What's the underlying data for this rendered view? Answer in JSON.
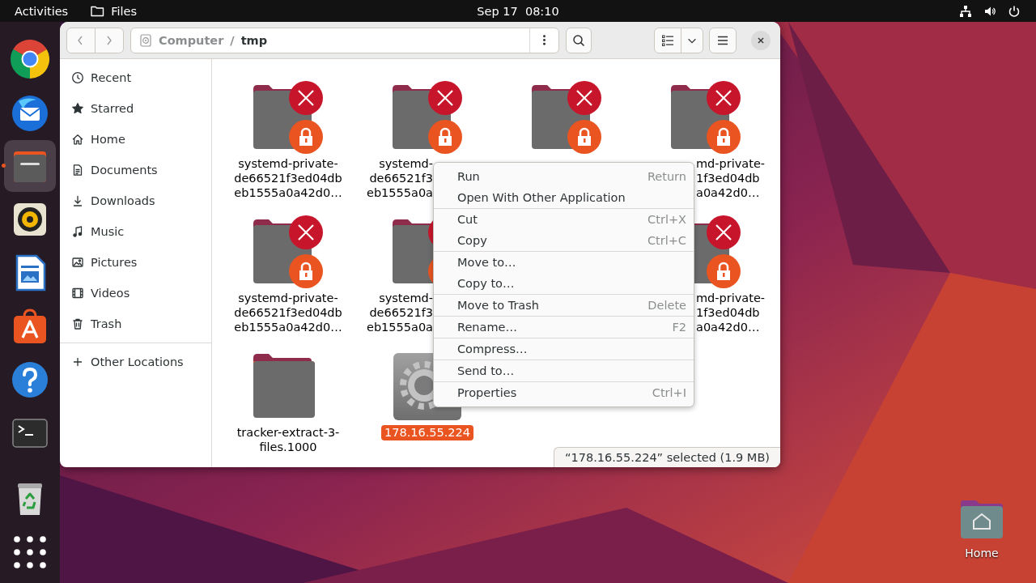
{
  "top_bar": {
    "activities": "Activities",
    "app_name": "Files",
    "clock": "Sep 17  08:10"
  },
  "dock": [
    {
      "kind": "browser",
      "running": false
    },
    {
      "kind": "mail",
      "running": false
    },
    {
      "kind": "files",
      "running": true
    },
    {
      "kind": "music",
      "running": false
    },
    {
      "kind": "writer",
      "running": false
    },
    {
      "kind": "store",
      "running": false
    },
    {
      "kind": "help",
      "running": false
    },
    {
      "kind": "terminal",
      "running": false
    },
    {
      "kind": "trash",
      "running": false
    },
    {
      "kind": "app-grid",
      "running": false
    }
  ],
  "window": {
    "path": [
      {
        "kind": "segment",
        "label": "Computer"
      },
      {
        "kind": "separator",
        "label": "/"
      },
      {
        "kind": "segment",
        "label": "tmp"
      }
    ],
    "sidebar": [
      {
        "kind": "recent",
        "label": "Recent",
        "selected": false
      },
      {
        "kind": "starred",
        "label": "Starred",
        "selected": false
      },
      {
        "kind": "home",
        "label": "Home",
        "selected": false
      },
      {
        "kind": "documents",
        "label": "Documents",
        "selected": false
      },
      {
        "kind": "downloads",
        "label": "Downloads",
        "selected": false
      },
      {
        "kind": "music",
        "label": "Music",
        "selected": false
      },
      {
        "kind": "pictures",
        "label": "Pictures",
        "selected": false
      },
      {
        "kind": "videos",
        "label": "Videos",
        "selected": false
      },
      {
        "kind": "trash",
        "label": "Trash",
        "selected": false
      },
      {
        "kind": "other",
        "label": "Other Locations",
        "selected": false
      }
    ],
    "items": [
      {
        "kind": "locked-folder",
        "label_lines": [
          "systemd-private-",
          "de66521f3ed04db",
          "eb1555a0a42d0…"
        ],
        "selected": false
      },
      {
        "kind": "locked-folder",
        "label_lines": [
          "systemd-",
          "de66521f3",
          "eb1555a0a"
        ],
        "selected": false
      },
      {
        "kind": "locked-folder",
        "selected": false
      },
      {
        "kind": "locked-folder",
        "label_lines": [
          "md-private-",
          "1f3ed04db",
          "a0a42d0…"
        ],
        "selected": false
      },
      {
        "kind": "locked-folder",
        "label_lines": [
          "systemd-private-",
          "de66521f3ed04db",
          "eb1555a0a42d0…"
        ],
        "selected": false
      },
      {
        "kind": "locked-folder",
        "label_lines": [
          "systemd-",
          "de66521f3",
          "eb1555a0a"
        ],
        "selected": false
      },
      {
        "kind": "locked-folder",
        "label_lines": [
          "md-private-",
          "1f3ed04db",
          "a0a42d0…"
        ],
        "selected": false
      },
      {
        "kind": "folder",
        "label_lines": [
          "tracker-extract-3-",
          "files.1000"
        ],
        "selected": false
      },
      {
        "kind": "executable",
        "label_lines": [
          "178.16.55.224"
        ],
        "selected": true
      }
    ],
    "status": "“178.16.55.224” selected (1.9 MB)"
  },
  "context_menu": {
    "sections": [
      [
        {
          "label": "Run",
          "shortcut": "Return"
        },
        {
          "label": "Open With Other Application"
        }
      ],
      [
        {
          "label": "Cut",
          "shortcut": "Ctrl+X"
        },
        {
          "label": "Copy",
          "shortcut": "Ctrl+C"
        }
      ],
      [
        {
          "label": "Move to…"
        },
        {
          "label": "Copy to…"
        }
      ],
      [
        {
          "label": "Move to Trash",
          "shortcut": "Delete"
        }
      ],
      [
        {
          "label": "Rename…",
          "shortcut": "F2"
        }
      ],
      [
        {
          "label": "Compress…"
        }
      ],
      [
        {
          "label": "Send to…"
        }
      ],
      [
        {
          "label": "Properties",
          "shortcut": "Ctrl+I"
        }
      ]
    ]
  },
  "desktop": [
    {
      "kind": "home-folder",
      "label": "Home"
    }
  ]
}
